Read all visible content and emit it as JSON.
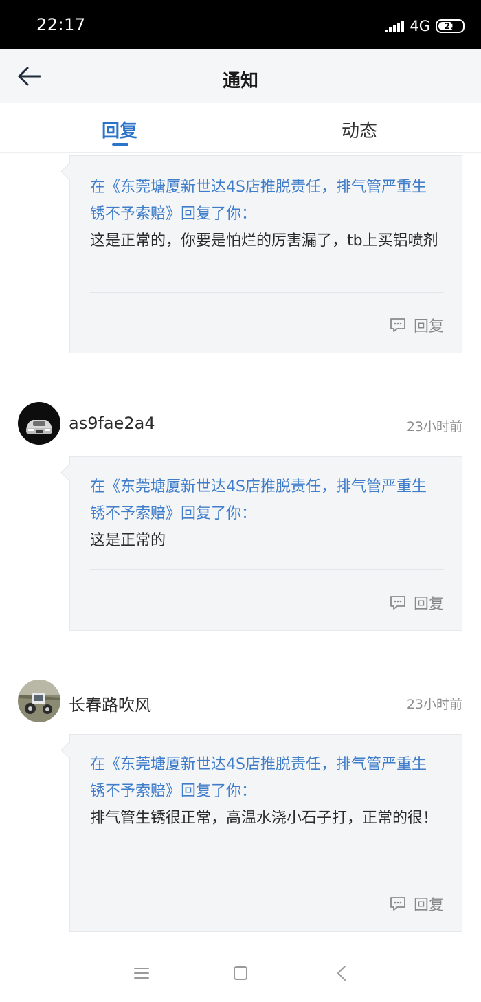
{
  "status_bar": {
    "time": "22:17",
    "network": "4G",
    "battery_level": "21"
  },
  "header": {
    "title": "通知",
    "back_icon": "arrow-left-icon"
  },
  "tabs": [
    {
      "label": "回复",
      "active": true
    },
    {
      "label": "动态",
      "active": false
    }
  ],
  "accent_color": "#2c74c9",
  "notifications": [
    {
      "source": "在《东莞塘厦新世达4S店推脱责任，排气管严重生锈不予索赔》回复了你：",
      "content": "这是正常的，你要是怕烂的厉害漏了，tb上买铝喷剂",
      "reply_label": "回复"
    },
    {
      "username": "as9fae2a4",
      "time": "23小时前",
      "avatar_icon": "car-avatar",
      "source": "在《东莞塘厦新世达4S店推脱责任，排气管严重生锈不予索赔》回复了你：",
      "content": "这是正常的",
      "reply_label": "回复"
    },
    {
      "username": "长春路吹风",
      "time": "23小时前",
      "avatar_icon": "tractor-avatar",
      "source": "在《东莞塘厦新世达4S店推脱责任，排气管严重生锈不予索赔》回复了你：",
      "content": "排气管生锈很正常，高温水浇小石子打，正常的很！",
      "reply_label": "回复"
    }
  ],
  "system_nav": [
    "menu-icon",
    "home-icon",
    "back-icon"
  ]
}
